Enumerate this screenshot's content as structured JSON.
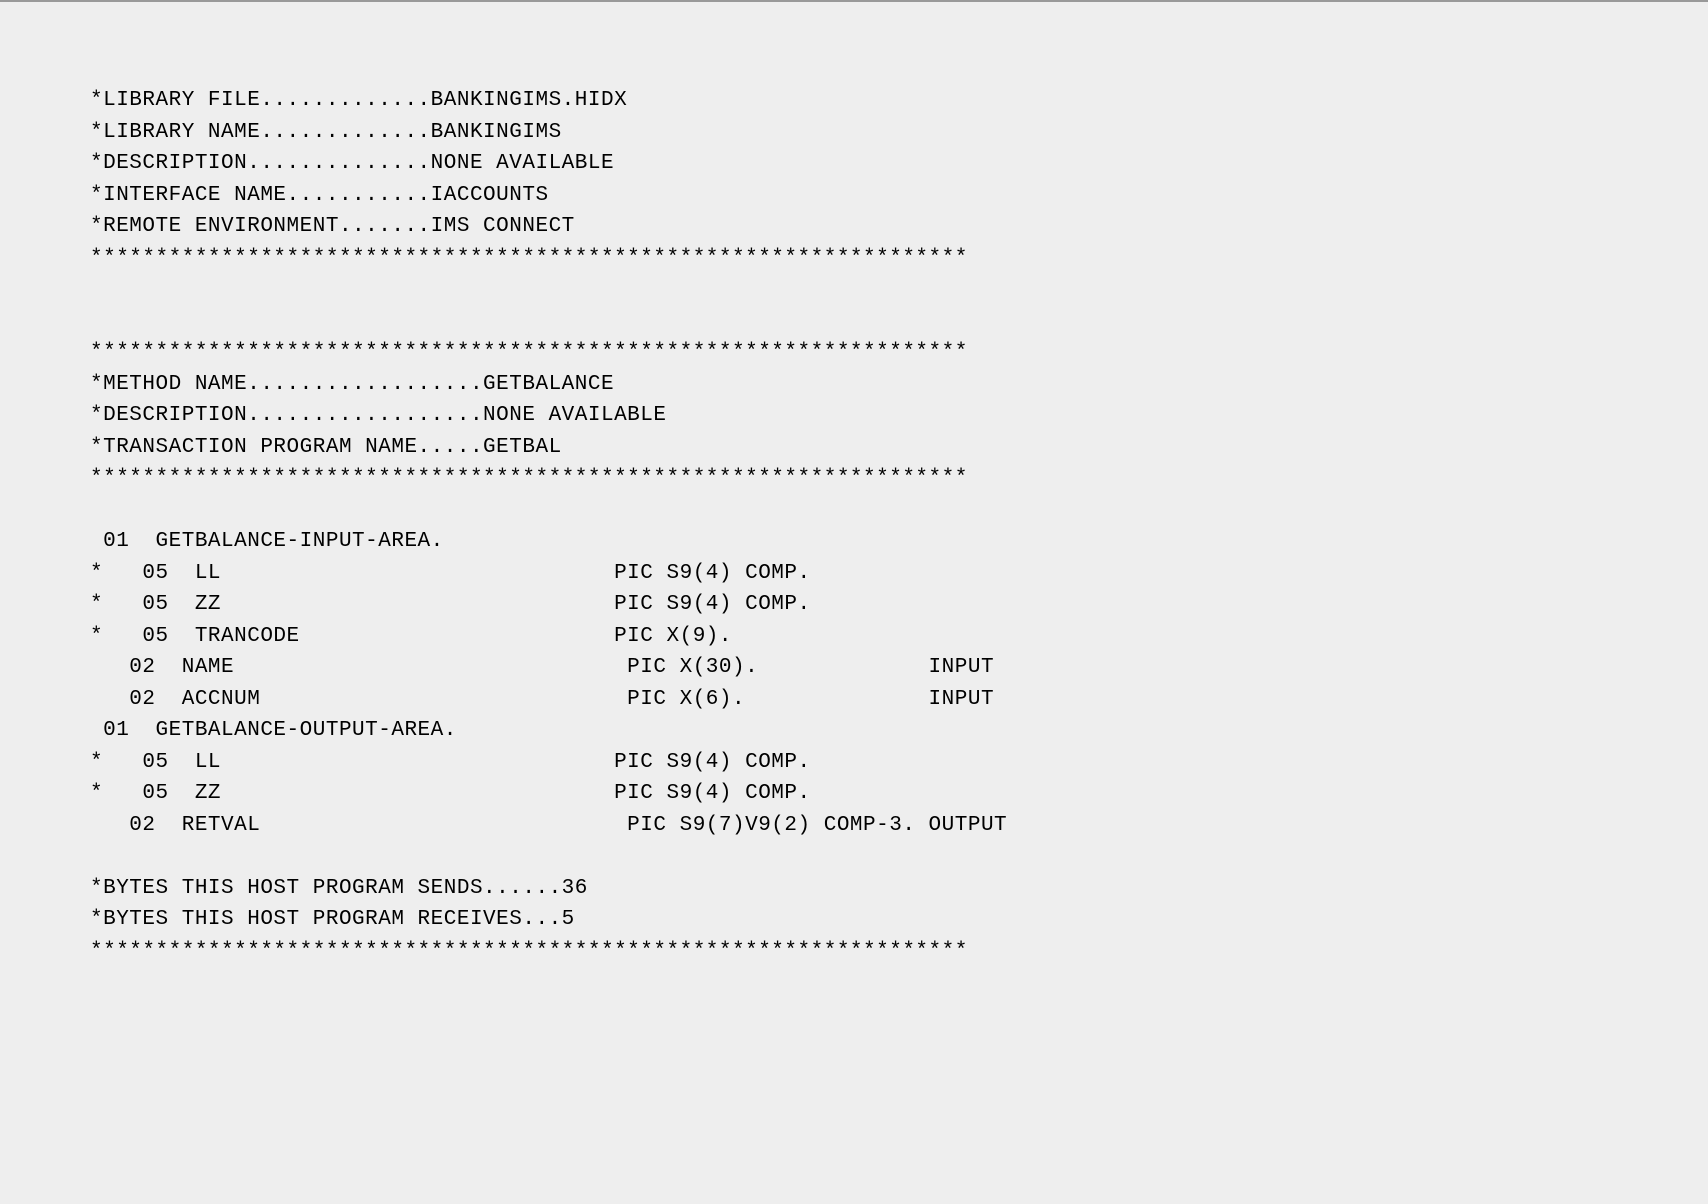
{
  "lines": [
    "*LIBRARY FILE.............BANKINGIMS.HIDX",
    "*LIBRARY NAME.............BANKINGIMS",
    "*DESCRIPTION..............NONE AVAILABLE",
    "*INTERFACE NAME...........IACCOUNTS",
    "*REMOTE ENVIRONMENT.......IMS CONNECT",
    "*******************************************************************",
    "",
    "",
    "*******************************************************************",
    "*METHOD NAME..................GETBALANCE",
    "*DESCRIPTION..................NONE AVAILABLE",
    "*TRANSACTION PROGRAM NAME.....GETBAL",
    "*******************************************************************",
    "",
    " 01  GETBALANCE-INPUT-AREA.",
    "*   05  LL                              PIC S9(4) COMP.",
    "*   05  ZZ                              PIC S9(4) COMP.",
    "*   05  TRANCODE                        PIC X(9).",
    "   02  NAME                              PIC X(30).             INPUT",
    "   02  ACCNUM                            PIC X(6).              INPUT",
    " 01  GETBALANCE-OUTPUT-AREA.",
    "*   05  LL                              PIC S9(4) COMP.",
    "*   05  ZZ                              PIC S9(4) COMP.",
    "   02  RETVAL                            PIC S9(7)V9(2) COMP-3. OUTPUT",
    "",
    "*BYTES THIS HOST PROGRAM SENDS......36",
    "*BYTES THIS HOST PROGRAM RECEIVES...5",
    "*******************************************************************"
  ]
}
